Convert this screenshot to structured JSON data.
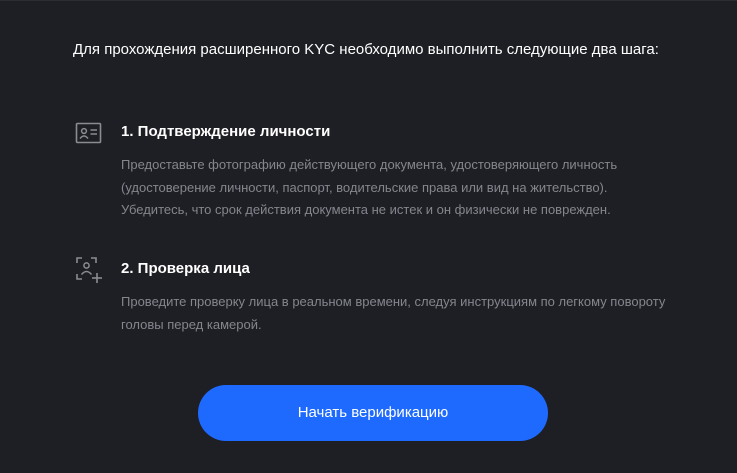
{
  "intro": "Для прохождения расширенного KYC необходимо выполнить следующие два шага:",
  "steps": [
    {
      "icon": "id-card-icon",
      "title": "1. Подтверждение личности",
      "description": "Предоставьте фотографию действующего документа, удостоверяющего личность (удостоверение личности, паспорт, водительские права или вид на жительство). Убедитесь, что срок действия документа не истек и он физически не поврежден."
    },
    {
      "icon": "face-scan-icon",
      "title": "2. Проверка лица",
      "description": "Проведите проверку лица в реальном времени, следуя инструкциям по легкому повороту головы перед камерой."
    }
  ],
  "button": {
    "label": "Начать верификацию"
  },
  "colors": {
    "background": "#1e1f24",
    "accent": "#1e6aff",
    "muted_text": "#84868e",
    "icon": "#8a8c93"
  }
}
